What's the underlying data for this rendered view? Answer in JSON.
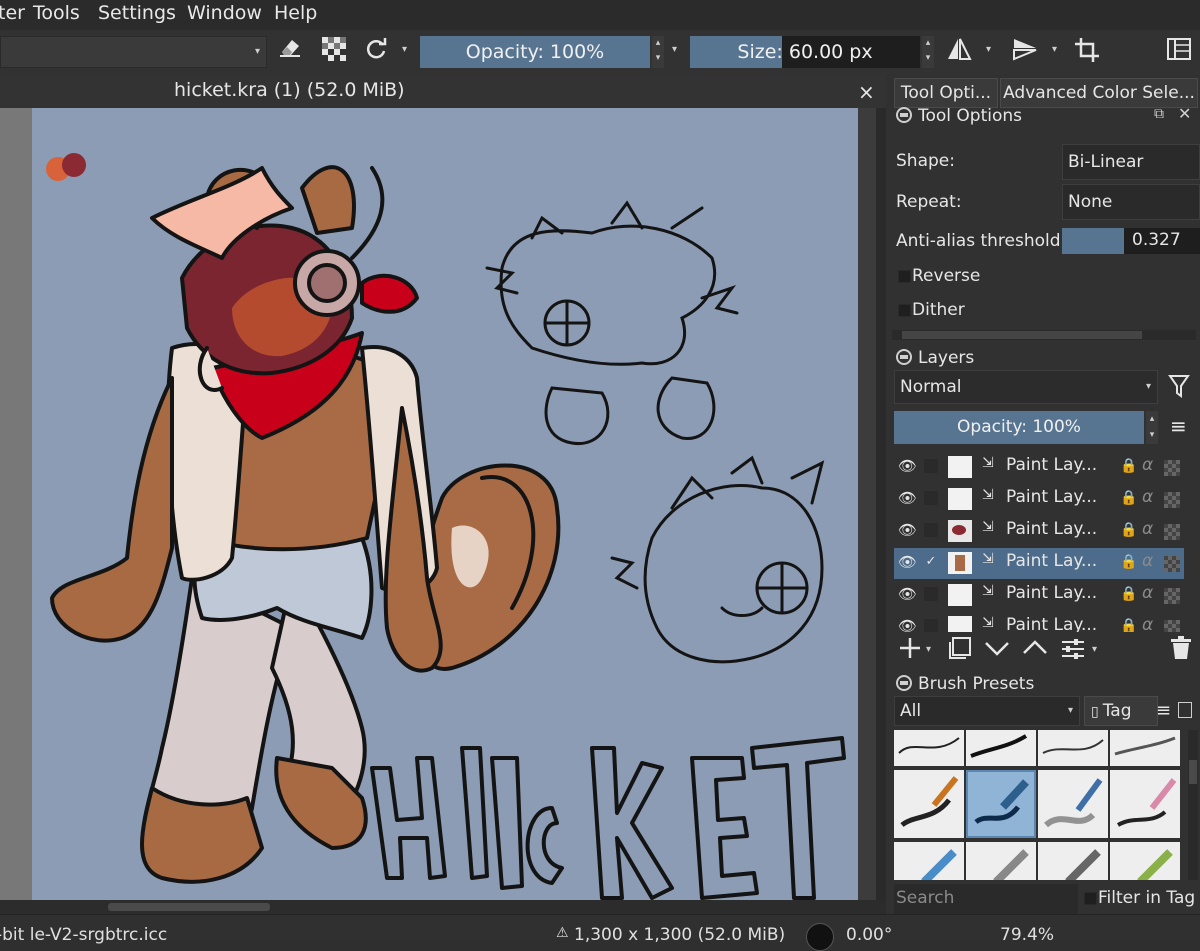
{
  "menubar": {
    "items": [
      "ter",
      "Tools",
      "Settings",
      "Window",
      "Help"
    ]
  },
  "toolbar": {
    "opacity_label": "Opacity: 100%",
    "size_label": "Size: 60.00 px",
    "opacity_value": 1.0
  },
  "document": {
    "tab_title": "hicket.kra (1) (52.0 MiB)",
    "close_glyph": "×"
  },
  "dock": {
    "tabs": [
      "Tool Opti...",
      "Advanced Color Sele..."
    ],
    "tool_options": {
      "title": "Tool Options",
      "shape_label": "Shape:",
      "shape_value": "Bi-Linear",
      "repeat_label": "Repeat:",
      "repeat_value": "None",
      "antialias_label": "Anti-alias threshold:",
      "antialias_value": "0.327",
      "reverse_label": "Reverse",
      "dither_label": "Dither"
    },
    "layers": {
      "title": "Layers",
      "blend_mode": "Normal",
      "opacity_label": "Opacity: 100%",
      "rows": [
        {
          "name": "Paint Lay...",
          "checked": "",
          "selected": false
        },
        {
          "name": "Paint Lay...",
          "checked": "",
          "selected": false
        },
        {
          "name": "Paint Lay...",
          "checked": "",
          "selected": false
        },
        {
          "name": "Paint Lay...",
          "checked": "✓",
          "selected": true
        },
        {
          "name": "Paint Lay...",
          "checked": "",
          "selected": false
        },
        {
          "name": "Paint Lay...",
          "checked": "",
          "selected": false
        }
      ]
    },
    "brush_presets": {
      "title": "Brush Presets",
      "filter_value": "All",
      "tag_label": "Tag",
      "search_placeholder": "Search",
      "filter_in_tag_label": "Filter in Tag"
    }
  },
  "statusbar": {
    "color_profile": "-bit   le-V2-srgbtrc.icc",
    "dimensions": "1,300 x 1,300 (52.0 MiB)",
    "rotation": "0.00°",
    "zoom": "79.4%"
  },
  "colors": {
    "accent": "#577591",
    "canvas_bg": "#8c9cb4",
    "selected_row": "#4d6c8c",
    "bandana_red": "#d4001a"
  },
  "artwork": {
    "lettering": "Hicket"
  }
}
